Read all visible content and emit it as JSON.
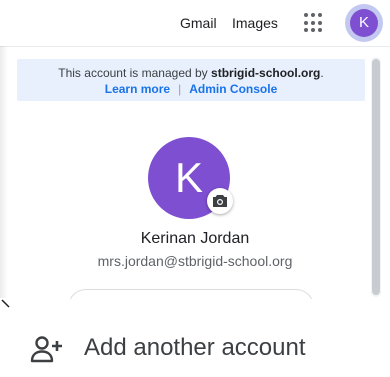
{
  "header": {
    "gmail_label": "Gmail",
    "images_label": "Images",
    "avatar_letter": "K"
  },
  "account_panel": {
    "managed_prefix": "This account is managed by",
    "managed_domain": "stbrigid-school.org",
    "managed_suffix": ".",
    "learn_more": "Learn more",
    "separator": "|",
    "admin_console": "Admin Console",
    "avatar_letter": "K",
    "name": "Kerinan Jordan",
    "email": "mrs.jordan@stbrigid-school.org",
    "avatar_color": "#7e4fd0"
  },
  "actions": {
    "add_account": "Add another account"
  }
}
